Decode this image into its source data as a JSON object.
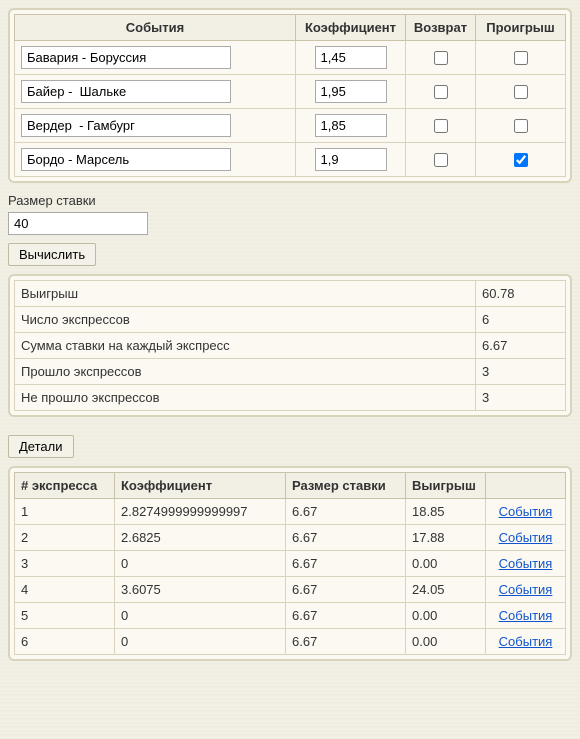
{
  "events_table": {
    "headers": [
      "События",
      "Коэффициент",
      "Возврат",
      "Проигрыш"
    ],
    "rows": [
      {
        "event": "Бавария - Боруссия",
        "coef": "1,45",
        "ret": false,
        "loss": false
      },
      {
        "event": "Байер -  Шальке",
        "coef": "1,95",
        "ret": false,
        "loss": false
      },
      {
        "event": "Вердер  - Гамбург",
        "coef": "1,85",
        "ret": false,
        "loss": false
      },
      {
        "event": "Бордо - Марсель",
        "coef": "1,9",
        "ret": false,
        "loss": true
      }
    ]
  },
  "stake": {
    "label": "Размер ставки",
    "value": "40"
  },
  "calc_button": "Вычислить",
  "results": {
    "rows": [
      {
        "label": "Выигрыш",
        "value": "60.78"
      },
      {
        "label": "Число экспрессов",
        "value": "6"
      },
      {
        "label": "Сумма ставки на каждый экспресс",
        "value": "6.67"
      },
      {
        "label": "Прошло экспрессов",
        "value": "3"
      },
      {
        "label": "Не прошло экспрессов",
        "value": "3"
      }
    ]
  },
  "details_button": "Детали",
  "details_table": {
    "headers": [
      "# экспресса",
      "Коэффициент",
      "Размер ставки",
      "Выигрыш",
      ""
    ],
    "link_label": "События",
    "rows": [
      {
        "n": "1",
        "coef": "2.8274999999999997",
        "stake": "6.67",
        "win": "18.85"
      },
      {
        "n": "2",
        "coef": "2.6825",
        "stake": "6.67",
        "win": "17.88"
      },
      {
        "n": "3",
        "coef": "0",
        "stake": "6.67",
        "win": "0.00"
      },
      {
        "n": "4",
        "coef": "3.6075",
        "stake": "6.67",
        "win": "24.05"
      },
      {
        "n": "5",
        "coef": "0",
        "stake": "6.67",
        "win": "0.00"
      },
      {
        "n": "6",
        "coef": "0",
        "stake": "6.67",
        "win": "0.00"
      }
    ]
  }
}
